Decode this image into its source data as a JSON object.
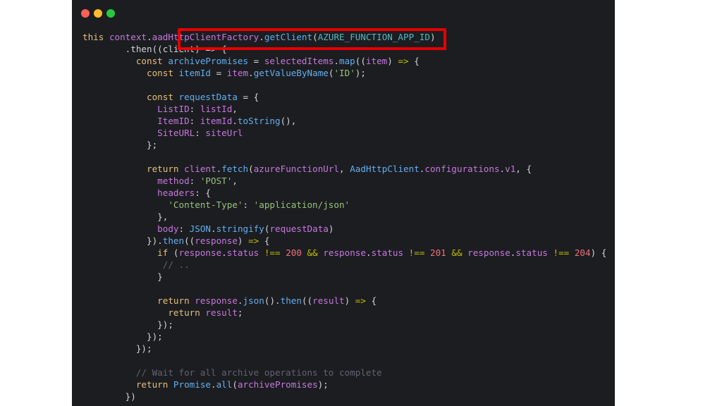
{
  "window": {
    "controls": [
      "close",
      "minimize",
      "maximize"
    ]
  },
  "code_lines": [
    [
      [
        "kw",
        "this"
      ],
      [
        "pl",
        " "
      ],
      [
        "pr",
        "context"
      ],
      [
        "pl",
        "."
      ],
      [
        "pr",
        "aadHttpClientFactory"
      ],
      [
        "pl",
        "."
      ],
      [
        "fn",
        "getClient"
      ],
      [
        "pl",
        "("
      ],
      [
        "cst",
        "AZURE_FUNCTION_APP_ID"
      ],
      [
        "pl",
        ")"
      ]
    ],
    [
      [
        "pl",
        "        .then((client) => {"
      ]
    ],
    [
      [
        "pl",
        "          "
      ],
      [
        "kw",
        "const"
      ],
      [
        "pl",
        " "
      ],
      [
        "fn",
        "archivePromises"
      ],
      [
        "pl",
        " = "
      ],
      [
        "pr",
        "selectedItems"
      ],
      [
        "pl",
        "."
      ],
      [
        "fn",
        "map"
      ],
      [
        "pl",
        "(("
      ],
      [
        "pr",
        "item"
      ],
      [
        "pl",
        ") "
      ],
      [
        "op",
        "=>"
      ],
      [
        "pl",
        " {"
      ]
    ],
    [
      [
        "pl",
        "            "
      ],
      [
        "kw",
        "const"
      ],
      [
        "pl",
        " "
      ],
      [
        "fn",
        "itemId"
      ],
      [
        "pl",
        " = "
      ],
      [
        "pr",
        "item"
      ],
      [
        "pl",
        "."
      ],
      [
        "fn",
        "getValueByName"
      ],
      [
        "pl",
        "("
      ],
      [
        "str",
        "'ID'"
      ],
      [
        "pl",
        ");"
      ]
    ],
    [
      [
        "pl",
        ""
      ]
    ],
    [
      [
        "pl",
        "            "
      ],
      [
        "kw",
        "const"
      ],
      [
        "pl",
        " "
      ],
      [
        "fn",
        "requestData"
      ],
      [
        "pl",
        " = {"
      ]
    ],
    [
      [
        "pl",
        "              "
      ],
      [
        "pr",
        "ListID"
      ],
      [
        "pl",
        ": "
      ],
      [
        "pr",
        "listId"
      ],
      [
        "pl",
        ","
      ]
    ],
    [
      [
        "pl",
        "              "
      ],
      [
        "pr",
        "ItemID"
      ],
      [
        "pl",
        ": "
      ],
      [
        "pr",
        "itemId"
      ],
      [
        "pl",
        "."
      ],
      [
        "fn",
        "toString"
      ],
      [
        "pl",
        "(),"
      ]
    ],
    [
      [
        "pl",
        "              "
      ],
      [
        "pr",
        "SiteURL"
      ],
      [
        "pl",
        ": "
      ],
      [
        "pr",
        "siteUrl"
      ]
    ],
    [
      [
        "pl",
        "            };"
      ]
    ],
    [
      [
        "pl",
        ""
      ]
    ],
    [
      [
        "pl",
        "            "
      ],
      [
        "kw",
        "return"
      ],
      [
        "pl",
        " "
      ],
      [
        "pr",
        "client"
      ],
      [
        "pl",
        "."
      ],
      [
        "fn",
        "fetch"
      ],
      [
        "pl",
        "("
      ],
      [
        "pr",
        "azureFunctionUrl"
      ],
      [
        "pl",
        ", "
      ],
      [
        "fn",
        "AadHttpClient"
      ],
      [
        "pl",
        "."
      ],
      [
        "pr",
        "configurations"
      ],
      [
        "pl",
        "."
      ],
      [
        "pr",
        "v1"
      ],
      [
        "pl",
        ", {"
      ]
    ],
    [
      [
        "pl",
        "              "
      ],
      [
        "pr",
        "method"
      ],
      [
        "pl",
        ": "
      ],
      [
        "str",
        "'POST'"
      ],
      [
        "pl",
        ","
      ]
    ],
    [
      [
        "pl",
        "              "
      ],
      [
        "pr",
        "headers"
      ],
      [
        "pl",
        ": {"
      ]
    ],
    [
      [
        "pl",
        "                "
      ],
      [
        "str",
        "'Content-Type'"
      ],
      [
        "pl",
        ": "
      ],
      [
        "str",
        "'application/json'"
      ]
    ],
    [
      [
        "pl",
        "              },"
      ]
    ],
    [
      [
        "pl",
        "              "
      ],
      [
        "pr",
        "body"
      ],
      [
        "pl",
        ": "
      ],
      [
        "fn",
        "JSON"
      ],
      [
        "pl",
        "."
      ],
      [
        "fn",
        "stringify"
      ],
      [
        "pl",
        "("
      ],
      [
        "pr",
        "requestData"
      ],
      [
        "pl",
        ")"
      ]
    ],
    [
      [
        "pl",
        "            })."
      ],
      [
        "fn",
        "then"
      ],
      [
        "pl",
        "(("
      ],
      [
        "pr",
        "response"
      ],
      [
        "pl",
        ") "
      ],
      [
        "op",
        "=>"
      ],
      [
        "pl",
        " {"
      ]
    ],
    [
      [
        "pl",
        "              "
      ],
      [
        "kw",
        "if"
      ],
      [
        "pl",
        " ("
      ],
      [
        "pr",
        "response"
      ],
      [
        "pl",
        "."
      ],
      [
        "pr",
        "status"
      ],
      [
        "pl",
        " "
      ],
      [
        "op",
        "!=="
      ],
      [
        "pl",
        " "
      ],
      [
        "num",
        "200"
      ],
      [
        "pl",
        " "
      ],
      [
        "op",
        "&&"
      ],
      [
        "pl",
        " "
      ],
      [
        "pr",
        "response"
      ],
      [
        "pl",
        "."
      ],
      [
        "pr",
        "status"
      ],
      [
        "pl",
        " "
      ],
      [
        "op",
        "!=="
      ],
      [
        "pl",
        " "
      ],
      [
        "num",
        "201"
      ],
      [
        "pl",
        " "
      ],
      [
        "op",
        "&&"
      ],
      [
        "pl",
        " "
      ],
      [
        "pr",
        "response"
      ],
      [
        "pl",
        "."
      ],
      [
        "pr",
        "status"
      ],
      [
        "pl",
        " "
      ],
      [
        "op",
        "!=="
      ],
      [
        "pl",
        " "
      ],
      [
        "num",
        "204"
      ],
      [
        "pl",
        ") {"
      ]
    ],
    [
      [
        "pl",
        "               "
      ],
      [
        "cm",
        "// .."
      ]
    ],
    [
      [
        "pl",
        "              }"
      ]
    ],
    [
      [
        "pl",
        ""
      ]
    ],
    [
      [
        "pl",
        "              "
      ],
      [
        "kw",
        "return"
      ],
      [
        "pl",
        " "
      ],
      [
        "pr",
        "response"
      ],
      [
        "pl",
        "."
      ],
      [
        "fn",
        "json"
      ],
      [
        "pl",
        "()."
      ],
      [
        "fn",
        "then"
      ],
      [
        "pl",
        "(("
      ],
      [
        "pr",
        "result"
      ],
      [
        "pl",
        ") "
      ],
      [
        "op",
        "=>"
      ],
      [
        "pl",
        " {"
      ]
    ],
    [
      [
        "pl",
        "                "
      ],
      [
        "kw",
        "return"
      ],
      [
        "pl",
        " "
      ],
      [
        "pr",
        "result"
      ],
      [
        "pl",
        ";"
      ]
    ],
    [
      [
        "pl",
        "              });"
      ]
    ],
    [
      [
        "pl",
        "            });"
      ]
    ],
    [
      [
        "pl",
        "          });"
      ]
    ],
    [
      [
        "pl",
        ""
      ]
    ],
    [
      [
        "pl",
        "          "
      ],
      [
        "cm",
        "// Wait for all archive operations to complete"
      ]
    ],
    [
      [
        "pl",
        "          "
      ],
      [
        "kw",
        "return"
      ],
      [
        "pl",
        " "
      ],
      [
        "fn",
        "Promise"
      ],
      [
        "pl",
        "."
      ],
      [
        "fn",
        "all"
      ],
      [
        "pl",
        "("
      ],
      [
        "pr",
        "archivePromises"
      ],
      [
        "pl",
        ");"
      ]
    ],
    [
      [
        "pl",
        "        })"
      ]
    ]
  ]
}
